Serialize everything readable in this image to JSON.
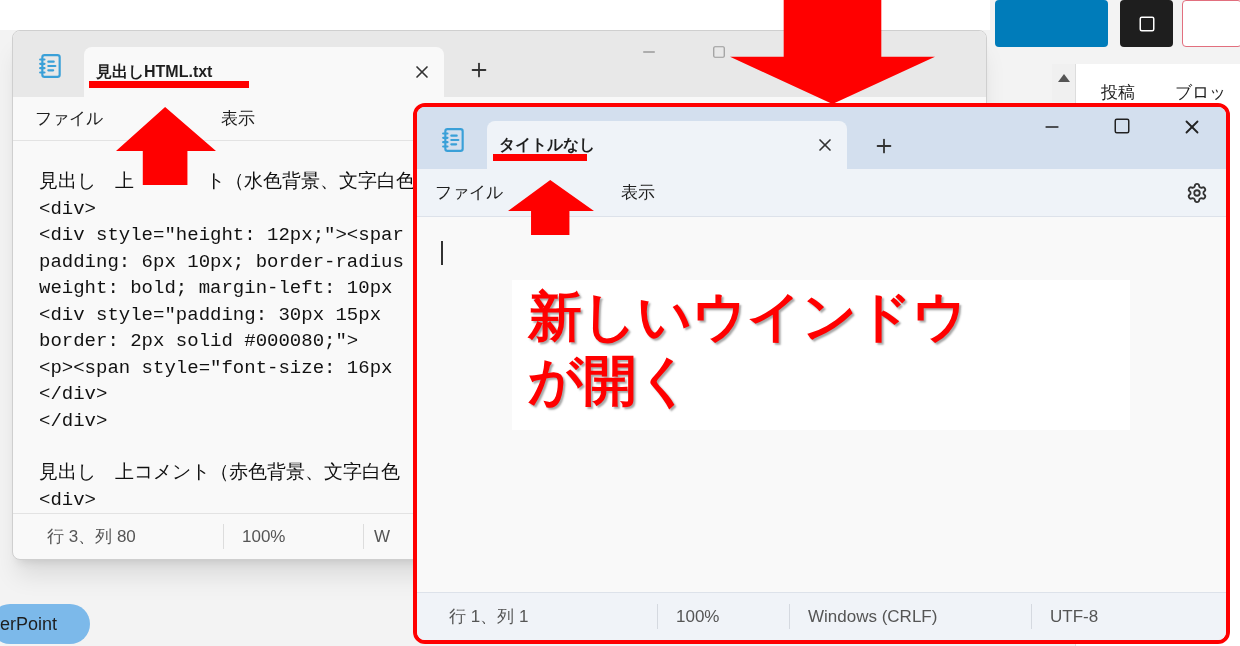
{
  "background": {
    "panel_tabs": [
      "投稿",
      "ブロッ"
    ],
    "pill": "erPoint"
  },
  "back_window": {
    "tab_title": "見出しHTML.txt",
    "menu": [
      "ファイル",
      "表示"
    ],
    "line_blocks": [
      [
        [
          "見出し　上",
          "ト（水色背景、文字白色"
        ],
        "<div>",
        "<div style=\"height: 12px;\"><spar",
        "padding: 6px 10px; border-radius",
        "weight: bold; margin-left: 10px",
        "<div style=\"padding: 30px 15px",
        "border: 2px solid #000080;\">",
        "<p><span style=\"font-size: 16px",
        "</div>",
        "</div>"
      ],
      [
        "見出し　上コメント（赤色背景、文字白色",
        "<div>"
      ]
    ],
    "status": [
      "行 3、列 80",
      "100%",
      "W"
    ]
  },
  "front_window": {
    "tab_title": "タイトルなし",
    "menu": [
      "ファイル",
      "表示"
    ],
    "status": [
      "行 1、列 1",
      "100%",
      "Windows (CRLF)",
      "UTF-8"
    ]
  },
  "annotation": {
    "lines": [
      "新しいウインドウ",
      "が開く"
    ]
  }
}
